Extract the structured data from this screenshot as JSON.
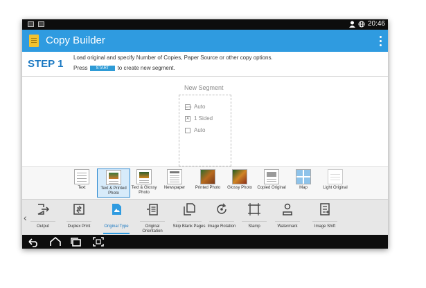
{
  "status_bar": {
    "time": "20:46",
    "icons": [
      "image-icon",
      "mail-icon",
      "person-icon",
      "globe-icon"
    ]
  },
  "app_bar": {
    "title": "Copy Builder",
    "menu_icon": "more-vert-icon",
    "color": "#2f9be0"
  },
  "step": {
    "label": "STEP 1",
    "line1": "Load original and specify Number of Copies, Paper Source or other copy options.",
    "line2_prefix": "Press",
    "start_label": "START",
    "line2_suffix": "to create new segment."
  },
  "segment": {
    "title": "New Segment",
    "rows": [
      {
        "icon": "paper-size-icon",
        "icon_text": "AUTO",
        "text": "Auto"
      },
      {
        "icon": "sided-icon",
        "icon_text": "A",
        "text": "1 Sided"
      },
      {
        "icon": "page-icon",
        "icon_text": "",
        "text": "Auto"
      }
    ]
  },
  "original_types": [
    {
      "label": "Text",
      "selected": false
    },
    {
      "label": "Text & Printed Photo",
      "selected": true
    },
    {
      "label": "Text & Glossy Photo",
      "selected": false
    },
    {
      "label": "Newspaper",
      "selected": false
    },
    {
      "label": "Printed Photo",
      "selected": false
    },
    {
      "label": "Glossy Photo",
      "selected": false
    },
    {
      "label": "Copied Original",
      "selected": false
    },
    {
      "label": "Map",
      "selected": false
    },
    {
      "label": "Light Original",
      "selected": false
    }
  ],
  "functions": [
    {
      "label": "Output",
      "icon": "output-icon",
      "selected": false
    },
    {
      "label": "Duplex Print",
      "icon": "duplex-print-icon",
      "selected": false
    },
    {
      "label": "Original Type",
      "icon": "original-type-icon",
      "selected": true
    },
    {
      "label": "Original Orientation",
      "icon": "original-orientation-icon",
      "selected": false
    },
    {
      "label": "Skip Blank Pages",
      "icon": "skip-blank-pages-icon",
      "selected": false
    },
    {
      "label": "Image Rotation",
      "icon": "image-rotation-icon",
      "selected": false
    },
    {
      "label": "Stamp",
      "icon": "stamp-icon",
      "selected": false
    },
    {
      "label": "Watermark",
      "icon": "watermark-icon",
      "selected": false
    },
    {
      "label": "Image Shift",
      "icon": "image-shift-icon",
      "selected": false
    }
  ],
  "nav_bar": {
    "buttons": [
      "back-icon",
      "home-icon",
      "recents-icon",
      "screenshot-icon"
    ]
  }
}
